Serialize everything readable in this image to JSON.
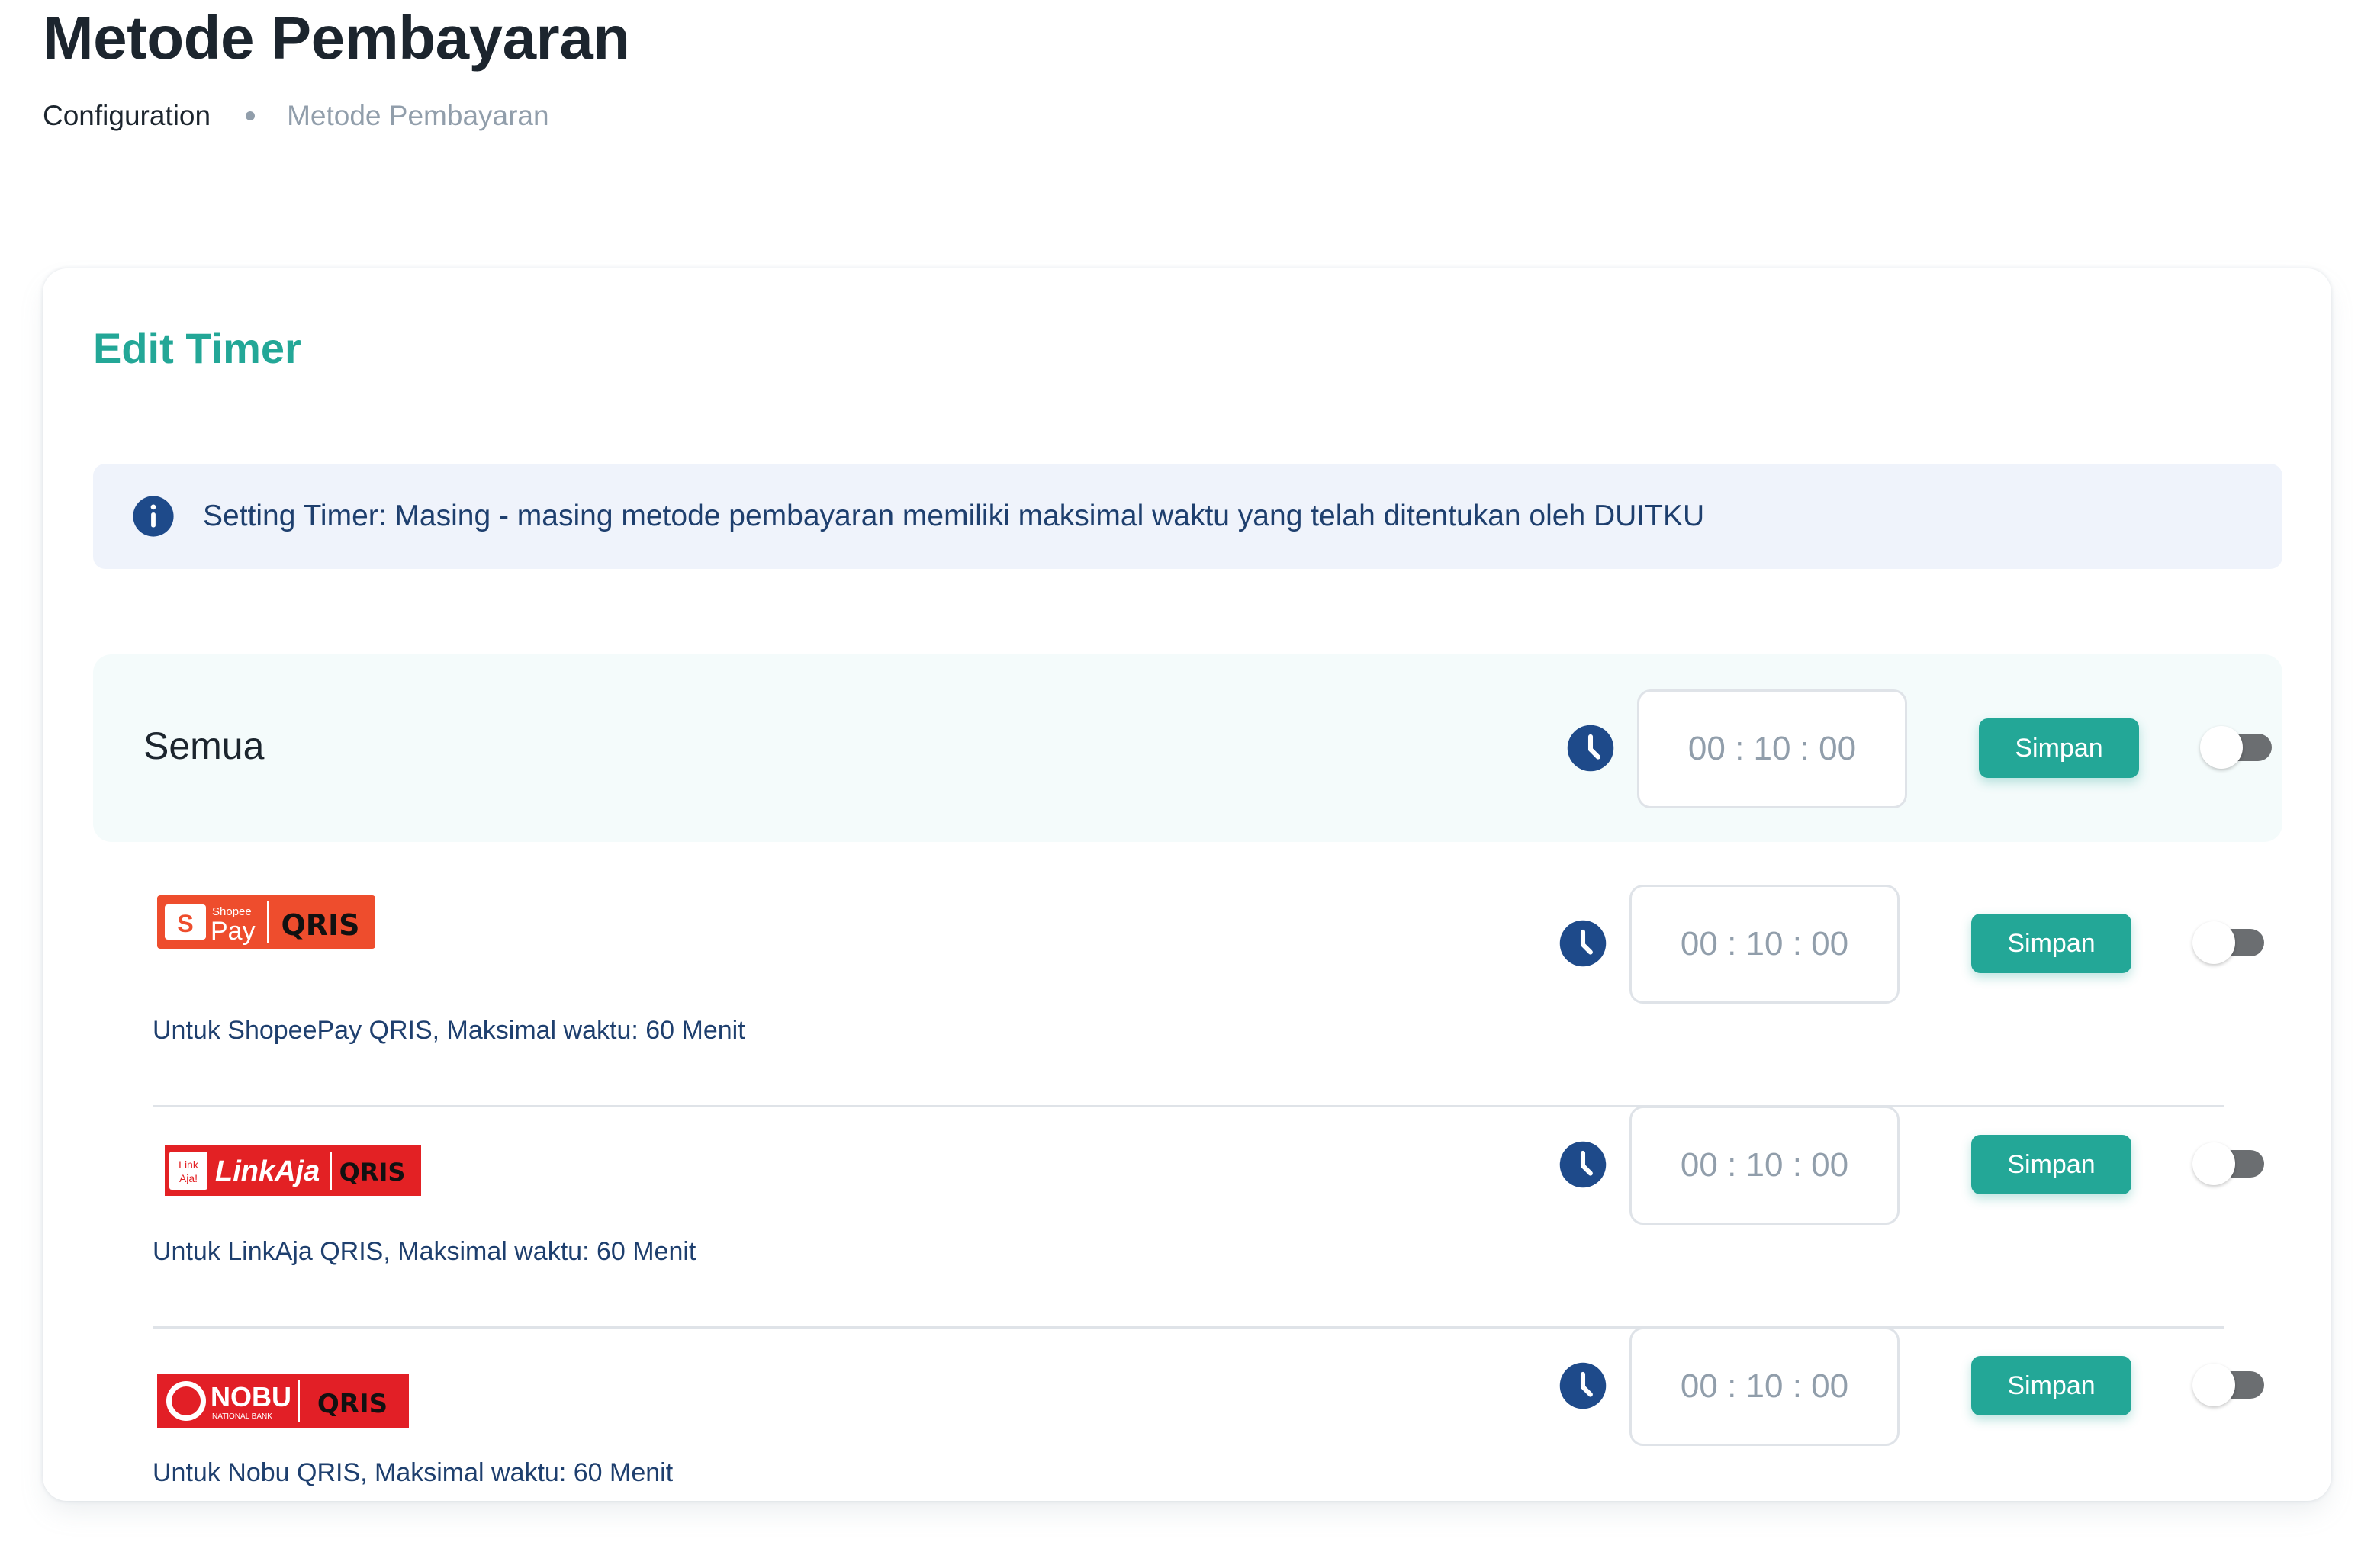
{
  "header": {
    "title": "Metode Pembayaran",
    "breadcrumb": [
      "Configuration",
      "Metode Pembayaran"
    ]
  },
  "card": {
    "title": "Edit Timer",
    "alert": "Setting Timer: Masing - masing metode pembayaran memiliki maksimal waktu yang telah ditentukan oleh DUITKU"
  },
  "all_row": {
    "label": "Semua",
    "time": "00 : 10 : 00",
    "save_label": "Simpan",
    "enabled": false
  },
  "methods": [
    {
      "logo": "shopeepay-qris-logo",
      "logo_text": [
        "Shopee",
        "Pay",
        "QRIS"
      ],
      "description": "Untuk ShopeePay QRIS, Maksimal waktu: 60 Menit",
      "time": "00 : 10 : 00",
      "save_label": "Simpan",
      "enabled": false
    },
    {
      "logo": "linkaja-qris-logo",
      "logo_text": [
        "LinkAja",
        "QRIS"
      ],
      "description": "Untuk LinkAja QRIS, Maksimal waktu: 60 Menit",
      "time": "00 : 10 : 00",
      "save_label": "Simpan",
      "enabled": false
    },
    {
      "logo": "nobu-qris-logo",
      "logo_text": [
        "NOBU",
        "NATIONAL BANK",
        "QRIS"
      ],
      "description": "Untuk Nobu QRIS, Maksimal waktu: 60 Menit",
      "time": "00 : 10 : 00",
      "save_label": "Simpan",
      "enabled": false
    }
  ],
  "icons": {
    "info": "info-circle-icon",
    "clock": "clock-icon"
  },
  "colors": {
    "accent": "#23a797",
    "info_bg": "#eff3fb",
    "info_text": "#1e3f6e",
    "icon_blue": "#1e4a8a",
    "toggle_off": "#6b6e71"
  }
}
